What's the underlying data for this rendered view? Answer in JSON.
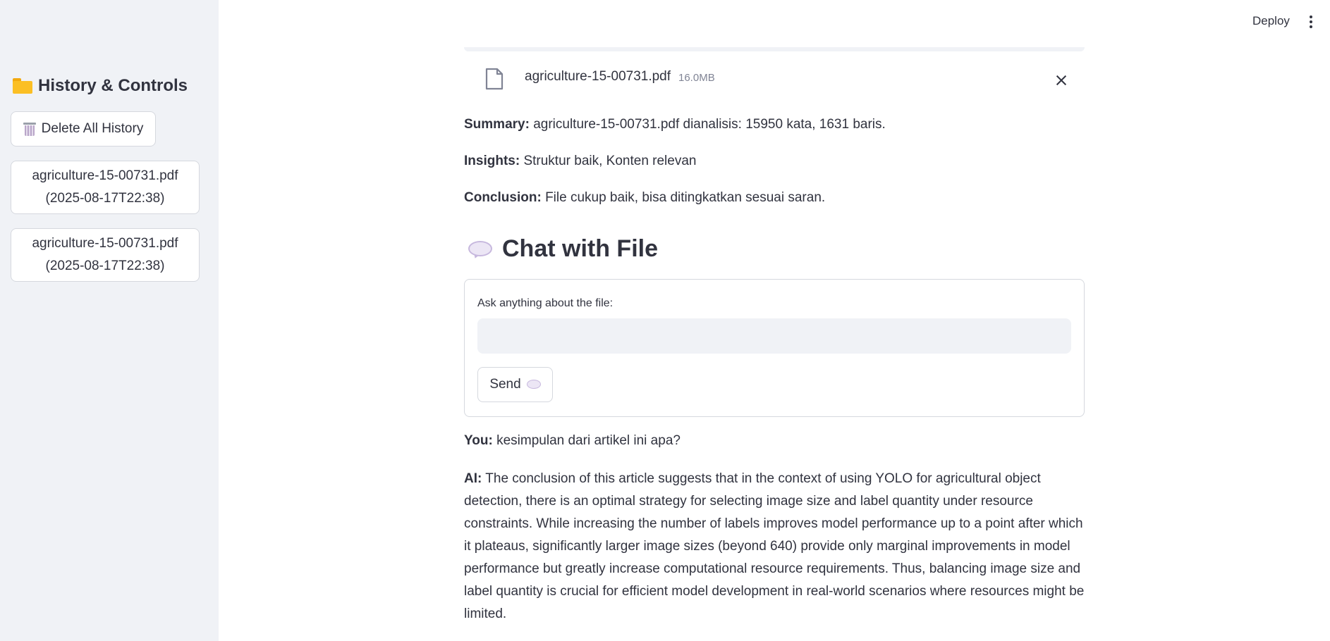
{
  "sidebar": {
    "title": "History & Controls",
    "title_icon": "folder-icon",
    "delete_label": "Delete All History",
    "delete_icon": "trash-icon",
    "history": [
      {
        "name": "agriculture-15-00731.pdf",
        "time": "(2025-08-17T22:38)"
      },
      {
        "name": "agriculture-15-00731.pdf",
        "time": "(2025-08-17T22:38)"
      }
    ]
  },
  "header": {
    "deploy_label": "Deploy",
    "menu_icon": "kebab-menu-icon"
  },
  "file": {
    "name": "agriculture-15-00731.pdf",
    "size": "16.0MB",
    "icon": "file-icon"
  },
  "analysis": {
    "summary_label": "Summary:",
    "summary_text": "agriculture-15-00731.pdf dianalisis: 15950 kata, 1631 baris.",
    "insights_label": "Insights:",
    "insights_text": "Struktur baik, Konten relevan",
    "conclusion_label": "Conclusion:",
    "conclusion_text": "File cukup baik, bisa ditingkatkan sesuai saran."
  },
  "chat": {
    "title": "Chat with File",
    "input_label": "Ask anything about the file:",
    "input_value": "",
    "send_label": "Send",
    "messages": [
      {
        "label": "You:",
        "text": "kesimpulan dari artikel ini apa?"
      },
      {
        "label": "AI:",
        "text": "The conclusion of this article suggests that in the context of using YOLO for agricultural object detection, there is an optimal strategy for selecting image size and label quantity under resource constraints. While increasing the number of labels improves model performance up to a point after which it plateaus, significantly larger image sizes (beyond 640) provide only marginal improvements in model performance but greatly increase computational resource requirements. Thus, balancing image size and label quantity is crucial for efficient model development in real-world scenarios where resources might be limited."
      }
    ]
  },
  "colors": {
    "sidebar_bg": "#f0f2f6",
    "text": "#31333f",
    "border": "#d5d8de"
  }
}
